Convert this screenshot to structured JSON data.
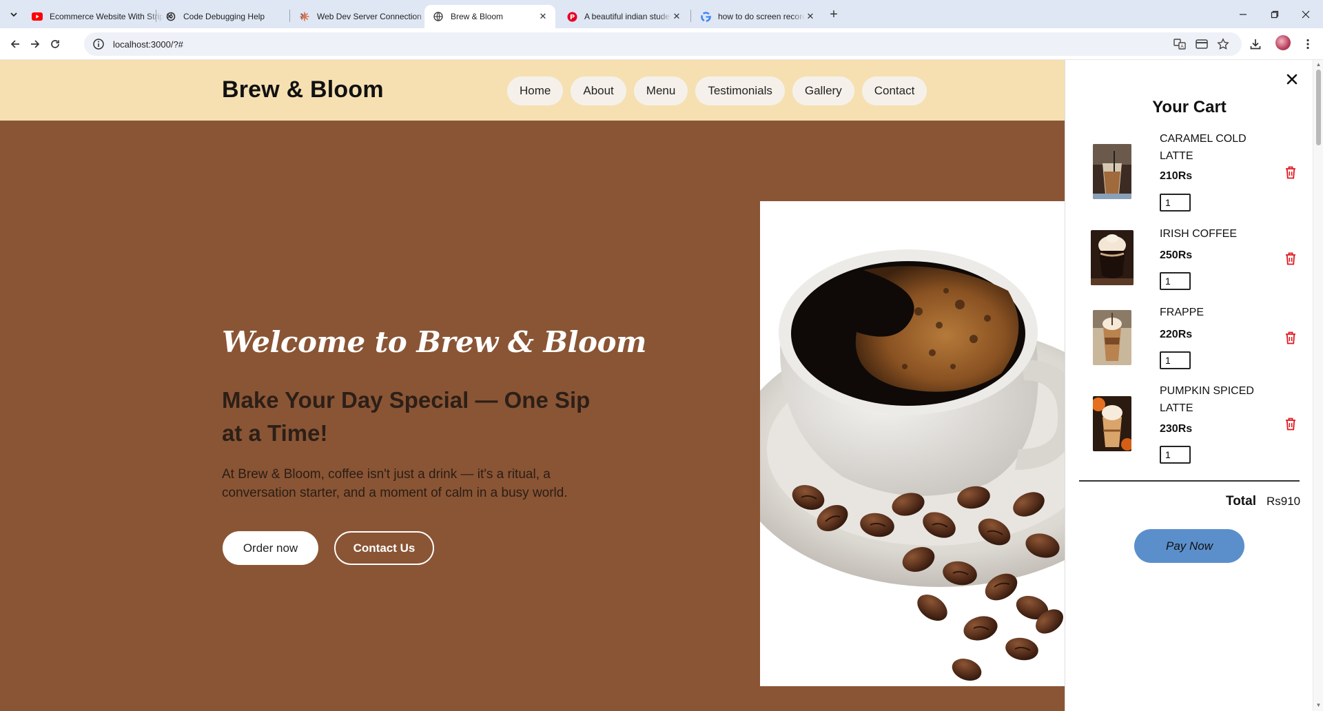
{
  "browser": {
    "tabs": [
      {
        "title": "Ecommerce Website With Stripe",
        "icon": "youtube-icon",
        "color": "#ff0000"
      },
      {
        "title": "Code Debugging Help",
        "icon": "chatgpt-icon",
        "color": "#333333"
      },
      {
        "title": "Web Dev Server Connection Error",
        "icon": "claude-icon",
        "color": "#d97757"
      },
      {
        "title": "Brew & Bloom",
        "icon": "globe-icon",
        "color": "#444444"
      },
      {
        "title": "A beautiful indian student girl w",
        "icon": "pinterest-icon",
        "color": "#e60023"
      },
      {
        "title": "how to do screen recording in w",
        "icon": "google-icon",
        "color": "#4285f4"
      }
    ],
    "active_tab_index": 3,
    "url": "localhost:3000/?#"
  },
  "site": {
    "brand": "Brew & Bloom",
    "nav": [
      "Home",
      "About",
      "Menu",
      "Testimonials",
      "Gallery",
      "Contact"
    ],
    "hero": {
      "title": "Welcome to Brew & Bloom",
      "subtitle": "Make Your Day Special — One Sip at a Time!",
      "description": "At Brew & Bloom, coffee isn't just a drink — it's a ritual, a conversation starter, and a moment of calm in a busy world.",
      "order_button": "Order now",
      "contact_button": "Contact Us"
    },
    "colors": {
      "header_bg": "#f6e0b2",
      "hero_bg": "#8a5535",
      "pay_button": "#5b8fcb",
      "delete_icon": "#e0161e"
    }
  },
  "cart": {
    "title": "Your Cart",
    "items": [
      {
        "name": "CARAMEL COLD LATTE",
        "price": "210Rs",
        "qty": "1"
      },
      {
        "name": "IRISH COFFEE",
        "price": "250Rs",
        "qty": "1"
      },
      {
        "name": "FRAPPE",
        "price": "220Rs",
        "qty": "1"
      },
      {
        "name": "PUMPKIN SPICED LATTE",
        "price": "230Rs",
        "qty": "1"
      }
    ],
    "total_label": "Total",
    "total_value": "Rs910",
    "pay_button": "Pay Now"
  }
}
